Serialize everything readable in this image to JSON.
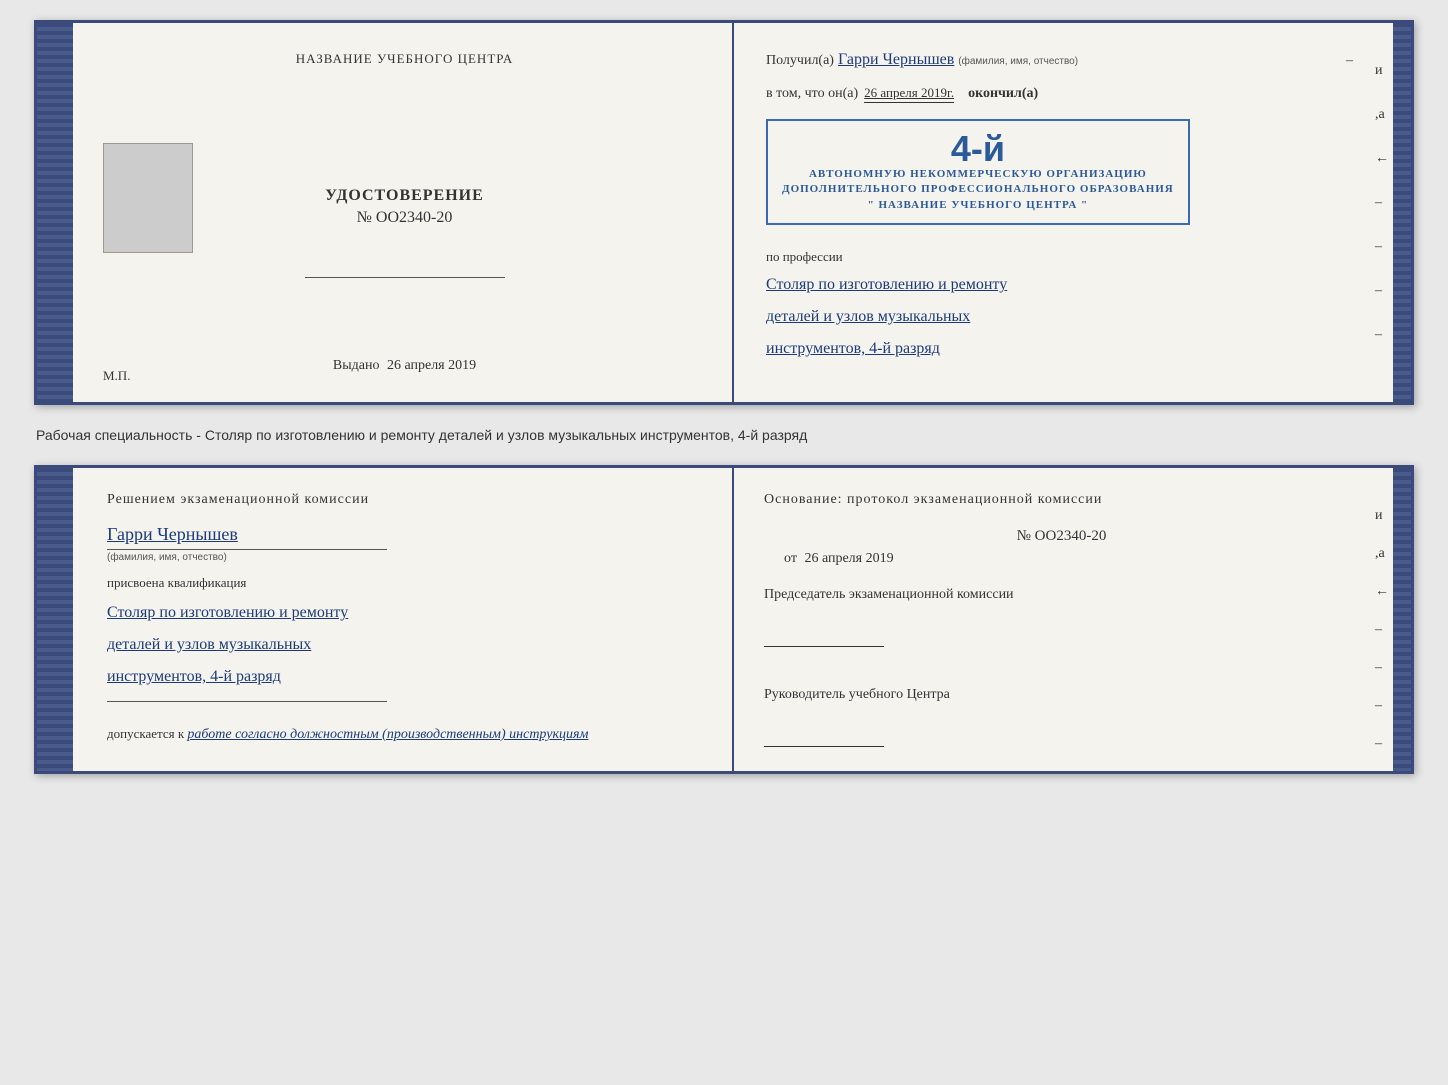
{
  "top_left": {
    "center_title": "НАЗВАНИЕ УЧЕБНОГО ЦЕНТРА",
    "udostoverenie_title": "УДОСТОВЕРЕНИЕ",
    "udostoverenie_num": "№ OO2340-20",
    "vydano_label": "Выдано",
    "vydano_date": "26 апреля 2019",
    "mp_label": "М.П."
  },
  "top_right": {
    "poluchil_label": "Получил(а)",
    "fio_value": "Гарри Чернышев",
    "fio_sublabel": "(фамилия, имя, отчество)",
    "dash1": "–",
    "vtom_label": "в том, что он(а)",
    "vtom_date": "26 апреля 2019г.",
    "okonchil_label": "окончил(а)",
    "stamp_rank": "4-й",
    "stamp_line1": "АВТОНОМНУЮ НЕКОММЕРЧЕСКУЮ ОРГАНИЗАЦИЮ",
    "stamp_line2": "ДОПОЛНИТЕЛЬНОГО ПРОФЕССИОНАЛЬНОГО ОБРАЗОВАНИЯ",
    "stamp_line3": "\" НАЗВАНИЕ УЧЕБНОГО ЦЕНТРА \"",
    "po_professii_label": "по профессии",
    "profession_line1": "Столяр по изготовлению и ремонту",
    "profession_line2": "деталей и узлов музыкальных",
    "profession_line3": "инструментов, 4-й разряд",
    "dash_и": "и",
    "dash_а": ",а",
    "dash_lt": "←",
    "dashes": [
      "–",
      "–",
      "–",
      "–"
    ]
  },
  "between_label": "Рабочая специальность - Столяр по изготовлению и ремонту деталей и узлов музыкальных инструментов, 4-й разряд",
  "bottom_left": {
    "resheniem_title": "Решением  экзаменационной  комиссии",
    "fio_value": "Гарри Чернышев",
    "fio_sublabel": "(фамилия, имя, отчество)",
    "prisvoena_label": "присвоена квалификация",
    "qualification_line1": "Столяр по изготовлению и ремонту",
    "qualification_line2": "деталей и узлов музыкальных",
    "qualification_line3": "инструментов, 4-й разряд",
    "dopuskaetsya_label": "допускается к",
    "dopusk_value": "работе согласно должностным (производственным) инструкциям"
  },
  "bottom_right": {
    "osnovanie_title": "Основание:  протокол  экзаменационной  комиссии",
    "num_value": "№  OO2340-20",
    "ot_label": "от",
    "ot_date": "26 апреля 2019",
    "predsedatel_title": "Председатель экзаменационной комиссии",
    "rukovoditel_title": "Руководитель учебного Центра",
    "dash_и": "и",
    "dash_а": ",а",
    "dash_lt": "←",
    "dashes": [
      "–",
      "–",
      "–",
      "–",
      "–",
      "–"
    ]
  }
}
